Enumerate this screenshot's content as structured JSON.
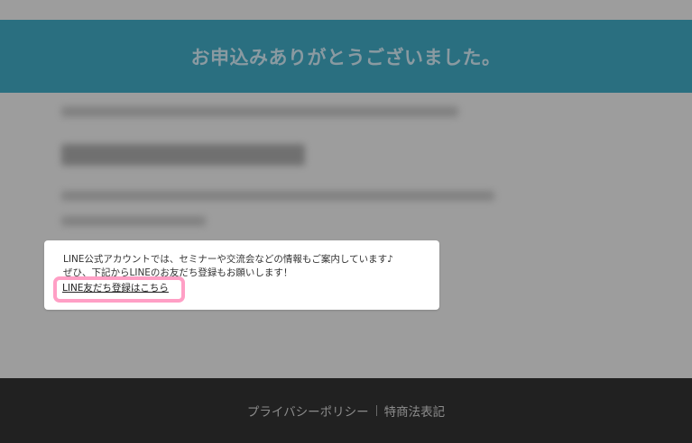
{
  "header": {
    "title": "お申込みありがとうございました。"
  },
  "modal": {
    "line1": "LINE公式アカウントでは、セミナーや交流会などの情報もご案内しています♪",
    "line2": "ぜひ、下記からLINEのお友だち登録もお願いします！",
    "link_label": "LINE友だち登録はこちら"
  },
  "footer": {
    "links": [
      {
        "label": "プライバシーポリシー"
      },
      {
        "label": "特商法表記"
      }
    ]
  },
  "colors": {
    "header_bg": "#2a6f80",
    "highlight_border": "#ff9fc5",
    "footer_bg": "#212121"
  }
}
